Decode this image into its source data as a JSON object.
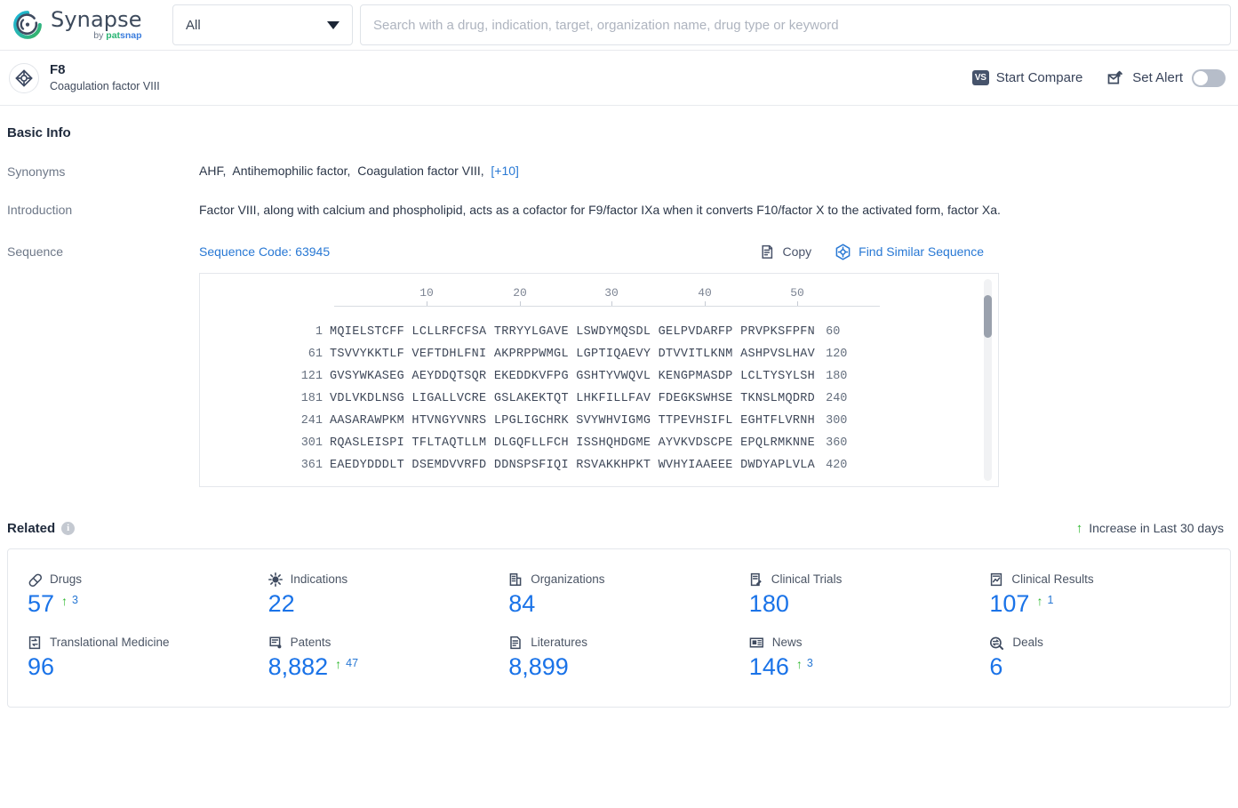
{
  "topbar": {
    "brand": {
      "name": "Synapse",
      "by": "by ",
      "pat": "pat",
      "snap": "snap"
    },
    "category_select": {
      "value": "All",
      "icon": "chevron-down-icon"
    },
    "search": {
      "value": "",
      "placeholder": "Search with a drug, indication, target, organization name, drug type or keyword"
    }
  },
  "entity": {
    "icon": "target-icon",
    "name": "F8",
    "description": "Coagulation factor VIII",
    "start_compare": {
      "label": "Start Compare",
      "badge": "VS"
    },
    "set_alert": {
      "label": "Set Alert",
      "icon": "alert-mail-icon",
      "toggle_on": false
    }
  },
  "basic_info": {
    "title": "Basic Info",
    "rows": {
      "synonyms_label": "Synonyms",
      "synonyms": [
        "AHF",
        "Antihemophilic factor",
        "Coagulation factor VIII"
      ],
      "synonyms_more": "[+10]",
      "introduction_label": "Introduction",
      "introduction": "Factor VIII, along with calcium and phospholipid, acts as a cofactor for F9/factor IXa when it converts F10/factor X to the activated form, factor Xa.",
      "sequence_label": "Sequence",
      "sequence_code": "Sequence Code: 63945",
      "copy_label": "Copy",
      "copy_icon": "copy-icon",
      "find_similar_label": "Find Similar Sequence",
      "find_similar_icon": "find-similar-icon"
    }
  },
  "sequence_viewer": {
    "ruler_ticks": [
      10,
      20,
      30,
      40,
      50
    ],
    "rows": [
      {
        "start": "1",
        "blocks": "MQIELSTCFF LCLLRFCFSA TRRYYLGAVE LSWDYMQSDL GELPVDARFP PRVPKSFPFN",
        "end": "60"
      },
      {
        "start": "61",
        "blocks": "TSVVYKKTLF VEFTDHLFNI AKPRPPWMGL LGPTIQAEVY DTVVITLKNM ASHPVSLHAV",
        "end": "120"
      },
      {
        "start": "121",
        "blocks": "GVSYWKASEG AEYDDQTSQR EKEDDKVFPG GSHTYVWQVL KENGPMASDP LCLTYSYLSH",
        "end": "180"
      },
      {
        "start": "181",
        "blocks": "VDLVKDLNSG LIGALLVCRE GSLAKEKTQT LHKFILLFAV FDEGKSWHSE TKNSLMQDRD",
        "end": "240"
      },
      {
        "start": "241",
        "blocks": "AASARAWPKM HTVNGYVNRS LPGLIGCHRK SVYWHVIGMG TTPEVHSIFL EGHTFLVRNH",
        "end": "300"
      },
      {
        "start": "301",
        "blocks": "RQASLEISPI TFLTAQTLLM DLGQFLLFCH ISSHQHDGME AYVKVDSCPE EPQLRMKNNE",
        "end": "360"
      },
      {
        "start": "361",
        "blocks": "EAEDYDDDLT DSEMDVVRFD DDNSPSFIQI RSVAKKHPKT WVHYIAAEEE DWDYAPLVLA",
        "end": "420"
      }
    ]
  },
  "related": {
    "title": "Related",
    "info_icon": "info-icon",
    "increase_note": "Increase in Last 30 days",
    "increase_arrow": "↑",
    "stats": [
      {
        "label": "Drugs",
        "icon": "pill-icon",
        "value": "57",
        "delta": "3"
      },
      {
        "label": "Indications",
        "icon": "virus-icon",
        "value": "22",
        "delta": ""
      },
      {
        "label": "Organizations",
        "icon": "building-icon",
        "value": "84",
        "delta": ""
      },
      {
        "label": "Clinical Trials",
        "icon": "clinical-trial-icon",
        "value": "180",
        "delta": ""
      },
      {
        "label": "Clinical Results",
        "icon": "clinical-result-icon",
        "value": "107",
        "delta": "1"
      },
      {
        "label": "Translational Medicine",
        "icon": "translational-icon",
        "value": "96",
        "delta": ""
      },
      {
        "label": "Patents",
        "icon": "patent-icon",
        "value": "8,882",
        "delta": "47"
      },
      {
        "label": "Literatures",
        "icon": "literature-icon",
        "value": "8,899",
        "delta": ""
      },
      {
        "label": "News",
        "icon": "news-icon",
        "value": "146",
        "delta": "3"
      },
      {
        "label": "Deals",
        "icon": "deal-icon",
        "value": "6",
        "delta": ""
      }
    ]
  },
  "colors": {
    "accent_blue": "#1a73e8",
    "link_blue": "#2878d4",
    "up_green": "#2eb82e",
    "text_dark": "#2b3648",
    "label_gray": "#6e7888"
  }
}
